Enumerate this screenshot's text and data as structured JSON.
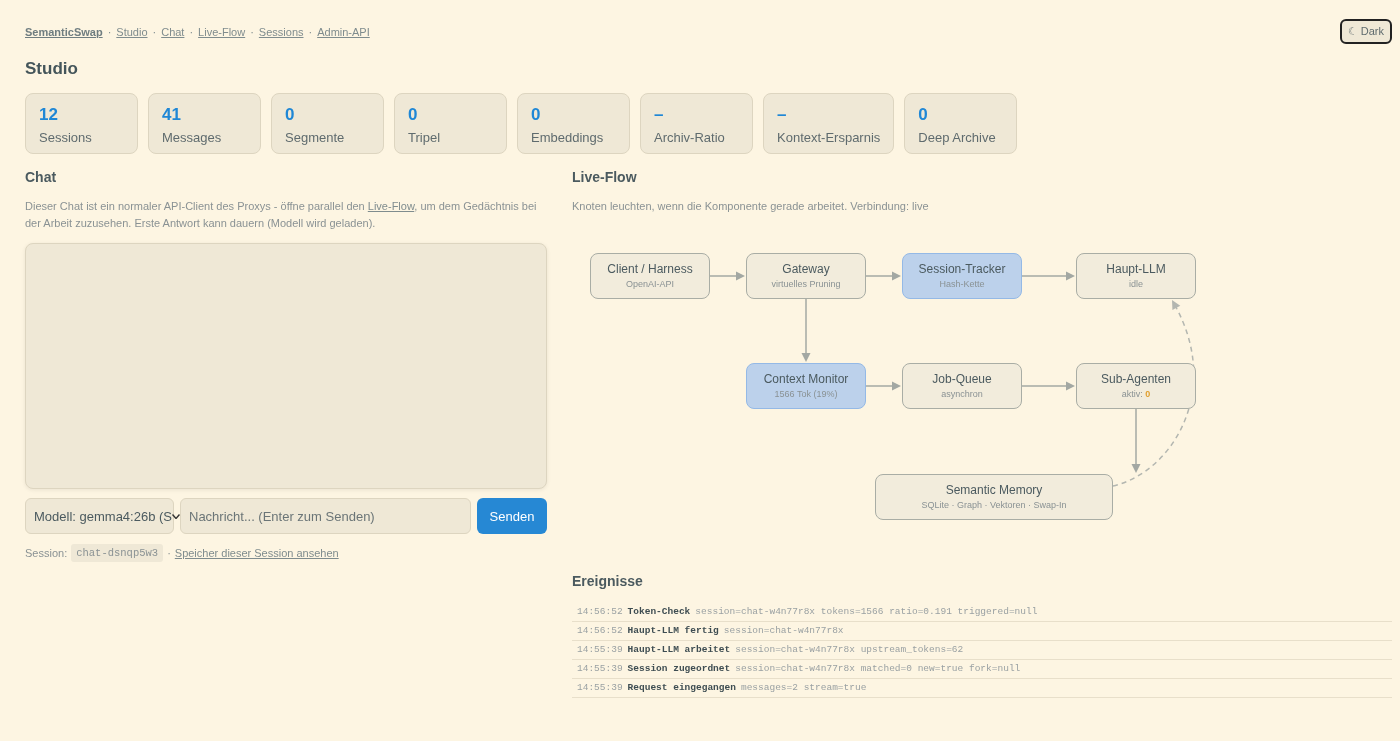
{
  "nav": {
    "brand": "SemanticSwap",
    "links": [
      {
        "separator": "·",
        "label": "Studio"
      },
      {
        "separator": "·",
        "label": "Chat"
      },
      {
        "separator": "·",
        "label": "Live-Flow"
      },
      {
        "separator": "·",
        "label": "Sessions"
      },
      {
        "separator": "·",
        "label": "Admin-API"
      }
    ]
  },
  "theme_toggle": {
    "label": "☾ Dark"
  },
  "page_title": "Studio",
  "stats": [
    {
      "value": "12",
      "label": "Sessions"
    },
    {
      "value": "41",
      "label": "Messages"
    },
    {
      "value": "0",
      "label": "Segmente"
    },
    {
      "value": "0",
      "label": "Tripel"
    },
    {
      "value": "0",
      "label": "Embeddings"
    },
    {
      "value": "–",
      "label": "Archiv-Ratio"
    },
    {
      "value": "–",
      "label": "Kontext-Ersparnis"
    },
    {
      "value": "0",
      "label": "Deep Archive"
    }
  ],
  "chat": {
    "title": "Chat",
    "description": {
      "before": "Dieser Chat ist ein normaler API-Client des Proxys - öffne parallel den ",
      "link": "Live-Flow",
      "after": ", um dem Gedächtnis bei der Arbeit zuzusehen. Erste Antwort kann dauern (Modell wird geladen)."
    },
    "model_select": "Modell: gemma4:26b (S",
    "message_input": {
      "placeholder": "Nachricht... (Enter zum Senden)"
    },
    "send_button": "Senden",
    "session": {
      "label": "Session:",
      "id": "chat-dsnqp5w3",
      "separator": "·",
      "link": "Speicher dieser Session ansehen"
    }
  },
  "flow": {
    "title": "Live-Flow",
    "description": "Knoten leuchten, wenn die Komponente gerade arbeitet. Verbindung: live",
    "nodes": [
      {
        "title": "Client / Harness",
        "subtitle": "OpenAI-API",
        "active": false
      },
      {
        "title": "Gateway",
        "subtitle": "virtuelles Pruning",
        "active": false
      },
      {
        "title": "Session-Tracker",
        "subtitle": "Hash-Kette",
        "active": true
      },
      {
        "title": "Haupt-LLM",
        "subtitle": "idle",
        "active": false
      },
      {
        "title": "Context Monitor",
        "subtitle": "1566 Tok (19%)",
        "active": true
      },
      {
        "title": "Job-Queue",
        "subtitle": "asynchron",
        "active": false
      },
      {
        "title": "Sub-Agenten",
        "subtitle": "aktiv: **0**",
        "active": false
      },
      {
        "title": "Semantic Memory",
        "subtitle": "SQLite · Graph · Vektoren · Swap-In",
        "active": false
      }
    ]
  },
  "events": {
    "title": "Ereignisse",
    "rows": [
      {
        "time": "14:56:52",
        "title": "Token-Check",
        "details": "session=chat-w4n77r8x tokens=1566 ratio=0.191 triggered=null"
      },
      {
        "time": "14:56:52",
        "title": "Haupt-LLM fertig",
        "details": "session=chat-w4n77r8x"
      },
      {
        "time": "14:55:39",
        "title": "Haupt-LLM arbeitet",
        "details": "session=chat-w4n77r8x upstream_tokens=62"
      },
      {
        "time": "14:55:39",
        "title": "Session zugeordnet",
        "details": "session=chat-w4n77r8x matched=0 new=true fork=null"
      },
      {
        "time": "14:55:39",
        "title": "Request eingegangen",
        "details": "messages=2 stream=true"
      }
    ]
  }
}
